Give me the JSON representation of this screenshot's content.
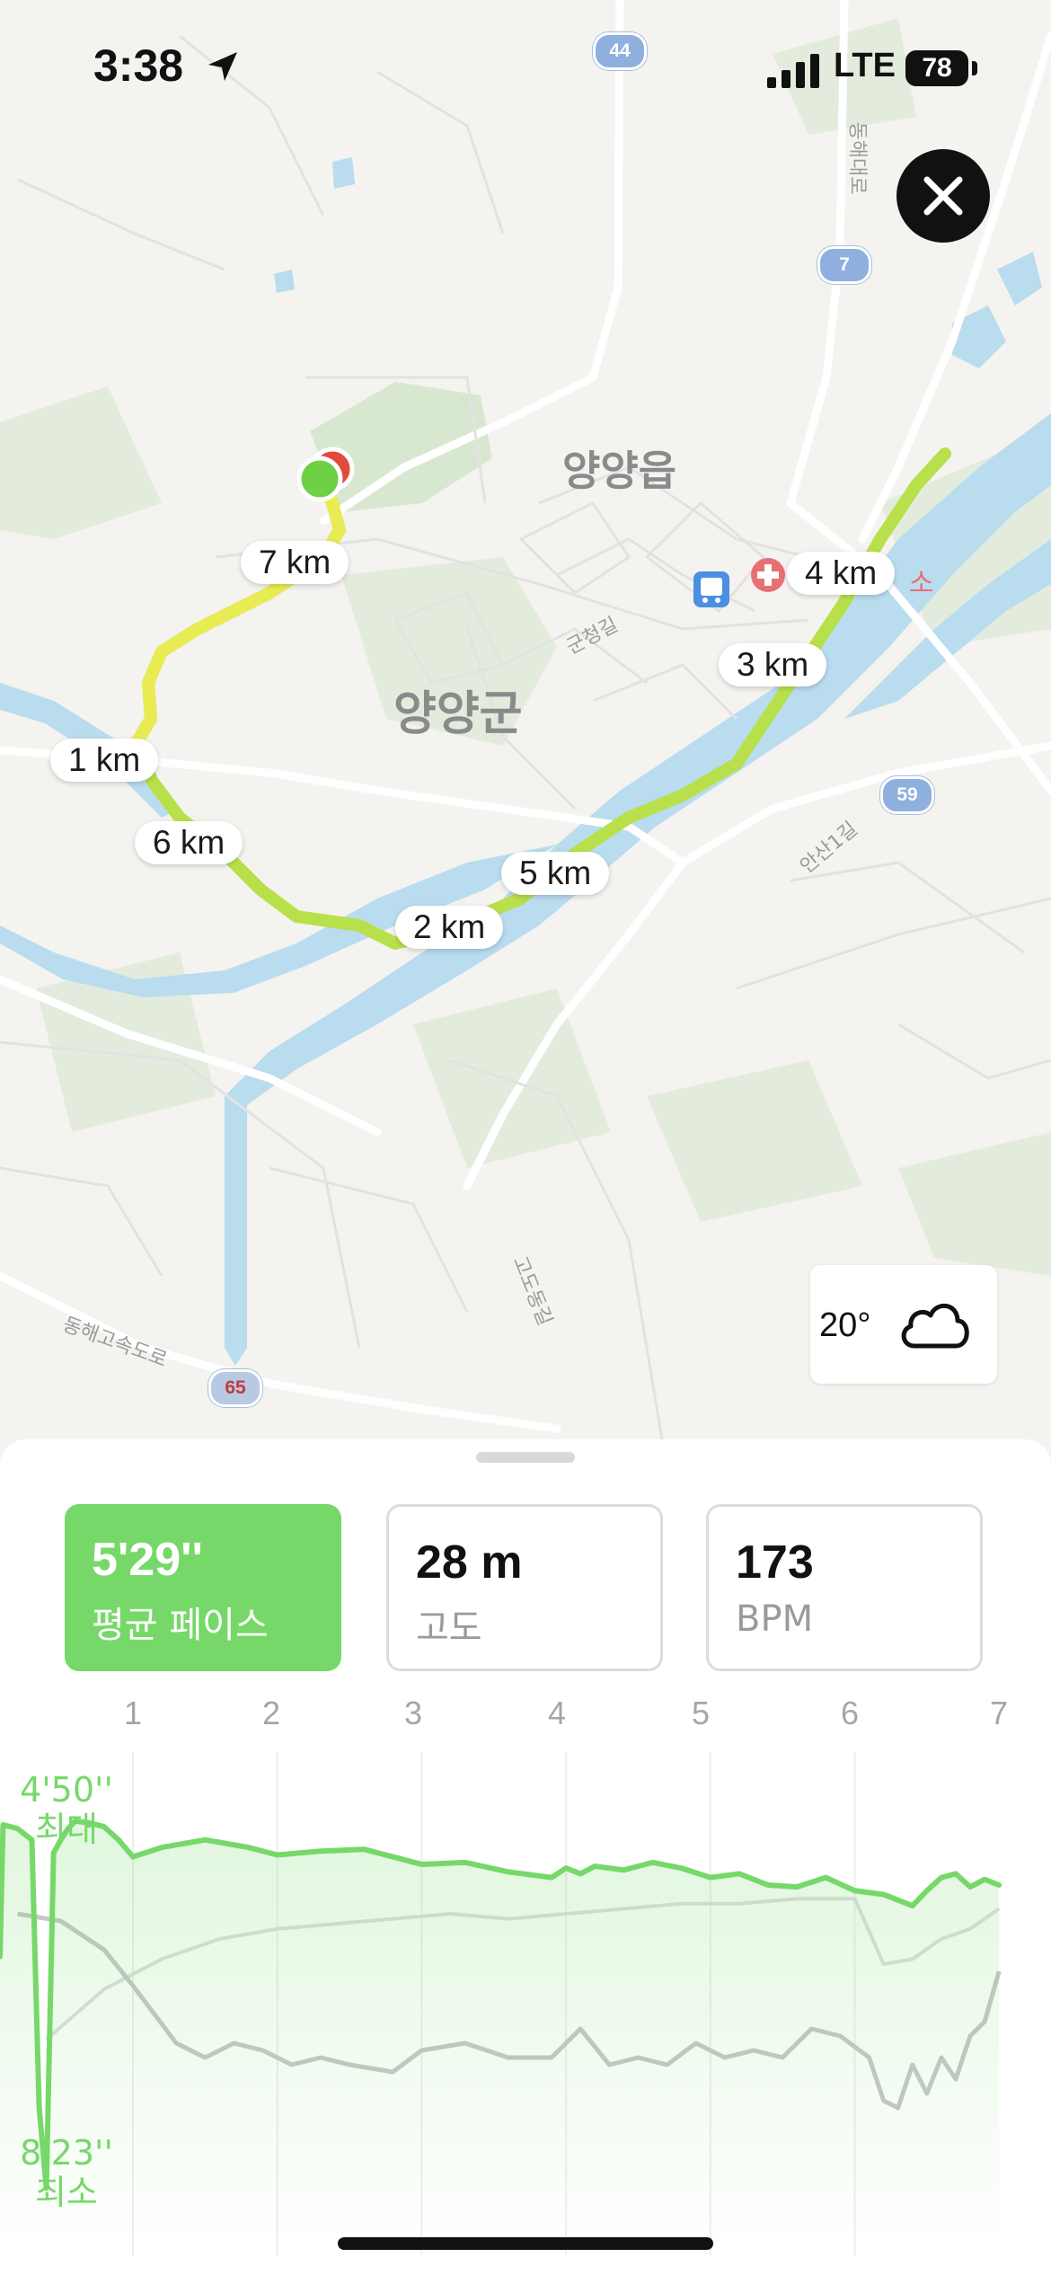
{
  "status_bar": {
    "time": "3:38",
    "network": "LTE",
    "battery": "78"
  },
  "map": {
    "place_labels": [
      "양양읍",
      "양양군"
    ],
    "road_labels": [
      "동해대로",
      "군청길",
      "안산1길",
      "고도동길",
      "동해고속도로"
    ],
    "route_shields": [
      "44",
      "7",
      "59",
      "65"
    ],
    "poi_partial_text": "소",
    "route_color": "#b8e04a",
    "km_markers": [
      "1 km",
      "2 km",
      "3 km",
      "4 km",
      "5 km",
      "6 km",
      "7 km"
    ],
    "weather": {
      "temperature": "20°",
      "icon": "cloud-icon"
    },
    "close_icon": "close-icon"
  },
  "metrics": [
    {
      "value": "5'29''",
      "label": "평균 페이스",
      "active": true
    },
    {
      "value": "28 m",
      "label": "고도",
      "active": false
    },
    {
      "value": "173",
      "label": "BPM",
      "active": false
    }
  ],
  "chart_data": {
    "type": "line",
    "x_ticks": [
      "1",
      "2",
      "3",
      "4",
      "5",
      "6",
      "7"
    ],
    "series": [
      {
        "color": "#77d86a",
        "x": [
          0.0,
          0.1,
          0.2,
          0.3,
          0.35,
          0.4,
          0.45,
          0.5,
          0.55,
          0.6,
          0.7,
          0.8,
          0.9,
          1.0,
          1.2,
          1.5,
          1.8,
          2.0,
          2.3,
          2.6,
          2.8,
          3.0,
          3.3,
          3.6,
          3.9,
          4.0,
          4.1,
          4.2,
          4.4,
          4.6,
          4.8,
          5.0,
          5.2,
          5.4,
          5.6,
          5.8,
          6.0,
          6.2,
          6.4,
          6.5,
          6.6,
          6.7,
          6.8,
          6.9,
          7.0
        ],
        "pace_sec": [
          380,
          310,
          312,
          318,
          460,
          503,
          325,
          318,
          312,
          308,
          309,
          311,
          318,
          327,
          322,
          318,
          322,
          326,
          324,
          323,
          327,
          331,
          330,
          335,
          338,
          333,
          336,
          332,
          334,
          330,
          333,
          338,
          336,
          342,
          343,
          338,
          345,
          347,
          353,
          345,
          338,
          336,
          343,
          339,
          342
        ]
      },
      {
        "color": "#c6c6c6",
        "x": [
          0.2,
          0.5,
          0.8,
          1.0,
          1.3,
          1.5,
          1.7,
          1.9,
          2.1,
          2.3,
          2.5,
          2.8,
          3.0,
          3.3,
          3.6,
          3.9,
          4.1,
          4.3,
          4.5,
          4.7,
          4.9,
          5.1,
          5.3,
          5.5,
          5.7,
          5.9,
          6.1,
          6.2,
          6.3,
          6.4,
          6.5,
          6.6,
          6.7,
          6.8,
          6.9,
          7.0
        ],
        "elevation_m": [
          30,
          29,
          25,
          20,
          12,
          10,
          12,
          11,
          9,
          10,
          9,
          8,
          11,
          12,
          10,
          10,
          14,
          9,
          10,
          9,
          12,
          10,
          11,
          10,
          14,
          13,
          10,
          4,
          3,
          9,
          5,
          10,
          7,
          13,
          15,
          22
        ]
      },
      {
        "color": "#dedede",
        "x": [
          0.4,
          0.8,
          1.2,
          1.6,
          2.0,
          2.4,
          2.8,
          3.2,
          3.6,
          4.0,
          4.4,
          4.8,
          5.2,
          5.6,
          6.0,
          6.2,
          6.4,
          6.6,
          6.8,
          7.0
        ],
        "heart_rate_bpm": [
          150,
          160,
          166,
          170,
          172,
          173,
          174,
          175,
          174,
          175,
          176,
          177,
          177,
          178,
          178,
          165,
          166,
          170,
          172,
          176
        ]
      }
    ],
    "annotations": [
      {
        "value": "4'50''",
        "label": "최대"
      },
      {
        "value": "8'23''",
        "label": "최소"
      }
    ]
  }
}
